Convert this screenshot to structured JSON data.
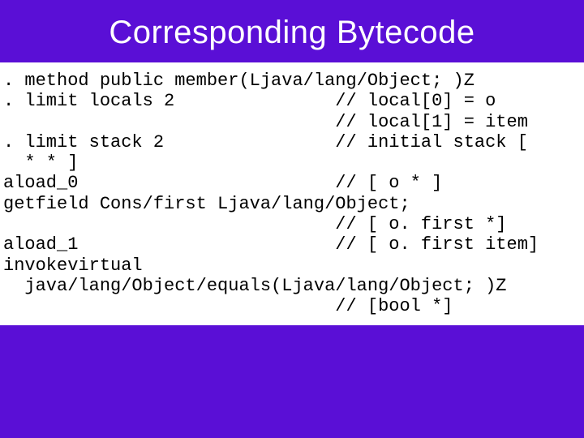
{
  "slide": {
    "title": "Corresponding Bytecode"
  },
  "code": {
    "l1": ". method public member(Ljava/lang/Object; )Z",
    "l2": ". limit locals 2               // local[0] = o",
    "l3": "                               // local[1] = item",
    "l4": ". limit stack 2                // initial stack [",
    "l5": "  * * ]",
    "l6": "aload_0                        // [ o * ]",
    "l7": "getfield Cons/first Ljava/lang/Object;",
    "l8": "                               // [ o. first *]",
    "l9": "aload_1                        // [ o. first item]",
    "l10": "invokevirtual",
    "l11": "  java/lang/Object/equals(Ljava/lang/Object; )Z",
    "l12": "                               // [bool *]"
  }
}
